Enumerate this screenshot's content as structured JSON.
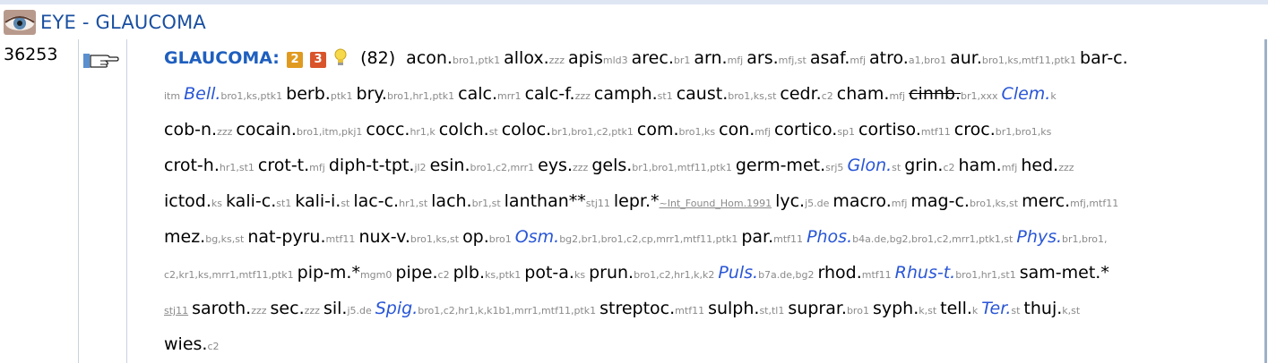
{
  "header": {
    "title": "EYE - GLAUCOMA",
    "icon": "eye-icon"
  },
  "rubric": {
    "number": "36253",
    "name": "GLAUCOMA:",
    "badges": [
      "2",
      "3"
    ],
    "count": "(82)",
    "lines": [
      [
        {
          "a": "acon.",
          "s": "bro1,ptk1"
        },
        {
          "a": "allox.",
          "s": "zzz"
        },
        {
          "a": "apis",
          "s": "mld3"
        },
        {
          "a": "arec.",
          "s": "br1"
        },
        {
          "a": "arn.",
          "s": "mfj"
        },
        {
          "a": "ars.",
          "s": "mfj,st"
        },
        {
          "a": "asaf.",
          "s": "mfj"
        },
        {
          "a": "atro.",
          "s": "a1,bro1"
        },
        {
          "a": "aur.",
          "s": "bro1,ks,mtf11,ptk1"
        },
        {
          "a": "bar-c.",
          "s": ""
        }
      ],
      [
        {
          "a": "",
          "s": "itm"
        },
        {
          "a": "Bell.",
          "s": "bro1,ks,ptk1",
          "i": true
        },
        {
          "a": "berb.",
          "s": "ptk1"
        },
        {
          "a": "bry.",
          "s": "bro1,hr1,ptk1"
        },
        {
          "a": "calc.",
          "s": "mrr1"
        },
        {
          "a": "calc-f.",
          "s": "zzz"
        },
        {
          "a": "camph.",
          "s": "st1"
        },
        {
          "a": "caust.",
          "s": "bro1,ks,st"
        },
        {
          "a": "cedr.",
          "s": "c2"
        },
        {
          "a": "cham.",
          "s": "mfj"
        },
        {
          "a": "cinnb.",
          "s": "br1,xxx",
          "x": true
        },
        {
          "a": "Clem.",
          "s": "k",
          "i": true
        }
      ],
      [
        {
          "a": "cob-n.",
          "s": "zzz"
        },
        {
          "a": "cocain.",
          "s": "bro1,itm,pkj1"
        },
        {
          "a": "cocc.",
          "s": "hr1,k"
        },
        {
          "a": "colch.",
          "s": "st"
        },
        {
          "a": "coloc.",
          "s": "br1,bro1,c2,ptk1"
        },
        {
          "a": "com.",
          "s": "bro1,ks"
        },
        {
          "a": "con.",
          "s": "mfj"
        },
        {
          "a": "cortico.",
          "s": "sp1"
        },
        {
          "a": "cortiso.",
          "s": "mtf11"
        },
        {
          "a": "croc.",
          "s": "br1,bro1,ks"
        }
      ],
      [
        {
          "a": "crot-h.",
          "s": "hr1,st1"
        },
        {
          "a": "crot-t.",
          "s": "mfj"
        },
        {
          "a": "diph-t-tpt.",
          "s": "jl2"
        },
        {
          "a": "esin.",
          "s": "bro1,c2,mrr1"
        },
        {
          "a": "eys.",
          "s": "zzz"
        },
        {
          "a": "gels.",
          "s": "br1,bro1,mtf11,ptk1"
        },
        {
          "a": "germ-met.",
          "s": "srj5"
        },
        {
          "a": "Glon.",
          "s": "st",
          "i": true
        },
        {
          "a": "grin.",
          "s": "c2"
        },
        {
          "a": "ham.",
          "s": "mfj"
        },
        {
          "a": "hed.",
          "s": "zzz"
        }
      ],
      [
        {
          "a": "ictod.",
          "s": "ks"
        },
        {
          "a": "kali-c.",
          "s": "st1"
        },
        {
          "a": "kali-i.",
          "s": "st"
        },
        {
          "a": "lac-c.",
          "s": "hr1,st"
        },
        {
          "a": "lach.",
          "s": "br1,st"
        },
        {
          "a": "lanthan**",
          "s": "stj11"
        },
        {
          "a": "lepr.*",
          "s": "~Int_Found_Hom.1991",
          "l": true
        },
        {
          "a": "lyc.",
          "s": "j5.de"
        },
        {
          "a": "macro.",
          "s": "mfj"
        },
        {
          "a": "mag-c.",
          "s": "bro1,ks,st"
        },
        {
          "a": "merc.",
          "s": "mfj,mtf11"
        }
      ],
      [
        {
          "a": "mez.",
          "s": "bg,ks,st"
        },
        {
          "a": "nat-pyru.",
          "s": "mtf11"
        },
        {
          "a": "nux-v.",
          "s": "bro1,ks,st"
        },
        {
          "a": "op.",
          "s": "bro1"
        },
        {
          "a": "Osm.",
          "s": "bg2,br1,bro1,c2,cp,mrr1,mtf11,ptk1",
          "i": true
        },
        {
          "a": "par.",
          "s": "mtf11"
        },
        {
          "a": "Phos.",
          "s": "b4a.de,bg2,bro1,c2,mrr1,ptk1,st",
          "i": true
        },
        {
          "a": "Phys.",
          "s": "br1,bro1,",
          "i": true
        }
      ],
      [
        {
          "a": "",
          "s": "c2,kr1,ks,mrr1,mtf11,ptk1"
        },
        {
          "a": "pip-m.*",
          "s": "mgm0"
        },
        {
          "a": "pipe.",
          "s": "c2"
        },
        {
          "a": "plb.",
          "s": "ks,ptk1"
        },
        {
          "a": "pot-a.",
          "s": "ks"
        },
        {
          "a": "prun.",
          "s": "bro1,c2,hr1,k,k2"
        },
        {
          "a": "Puls.",
          "s": "b7a.de,bg2",
          "i": true
        },
        {
          "a": "rhod.",
          "s": "mtf11"
        },
        {
          "a": "Rhus-t.",
          "s": "bro1,hr1,st1",
          "i": true
        },
        {
          "a": "sam-met.*",
          "s": ""
        }
      ],
      [
        {
          "a": "",
          "s": "stj11",
          "l": true
        },
        {
          "a": "saroth.",
          "s": "zzz"
        },
        {
          "a": "sec.",
          "s": "zzz"
        },
        {
          "a": "sil.",
          "s": "j5.de"
        },
        {
          "a": "Spig.",
          "s": "bro1,c2,hr1,k,k1b1,mrr1,mtf11,ptk1",
          "i": true
        },
        {
          "a": "streptoc.",
          "s": "mtf11"
        },
        {
          "a": "sulph.",
          "s": "st,tl1"
        },
        {
          "a": "suprar.",
          "s": "bro1"
        },
        {
          "a": "syph.",
          "s": "k,st"
        },
        {
          "a": "tell.",
          "s": "k"
        },
        {
          "a": "Ter.",
          "s": "st",
          "i": true
        },
        {
          "a": "thuj.",
          "s": "k,st"
        }
      ],
      [
        {
          "a": "wies.",
          "s": "c2"
        }
      ]
    ]
  }
}
